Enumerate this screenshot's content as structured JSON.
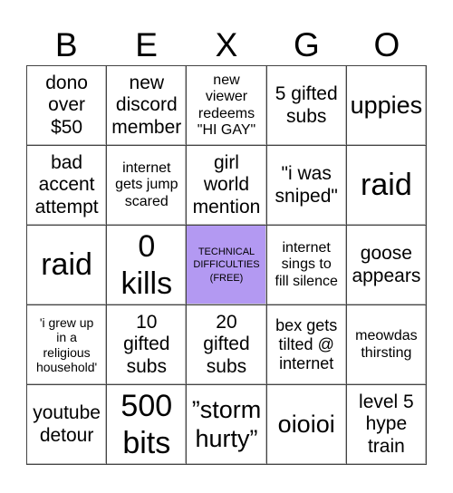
{
  "header": [
    "B",
    "E",
    "X",
    "G",
    "O"
  ],
  "free_color": "#b399f2",
  "cells": [
    {
      "text": "dono over $50",
      "lines": [
        "dono",
        "over",
        "$50"
      ],
      "size": "s-m"
    },
    {
      "text": "new discord member",
      "lines": [
        "new",
        "discord",
        "member"
      ],
      "size": "s-m"
    },
    {
      "text": "new viewer redeems \"HI GAY\"",
      "lines": [
        "new",
        "viewer",
        "redeems",
        "\"HI GAY\""
      ],
      "size": "s-xs"
    },
    {
      "text": "5 gifted subs",
      "lines": [
        "5 gifted",
        "subs"
      ],
      "size": "s-m"
    },
    {
      "text": "uppies",
      "lines": [
        "uppies"
      ],
      "size": "s-l"
    },
    {
      "text": "bad accent attempt",
      "lines": [
        "bad",
        "accent",
        "attempt"
      ],
      "size": "s-m"
    },
    {
      "text": "internet gets jump scared",
      "lines": [
        "internet",
        "gets jump",
        "scared"
      ],
      "size": "s-xs"
    },
    {
      "text": "girl world mention",
      "lines": [
        "girl",
        "world",
        "mention"
      ],
      "size": "s-m"
    },
    {
      "text": "\"i was sniped\"",
      "lines": [
        "\"i was",
        "sniped\""
      ],
      "size": "s-m"
    },
    {
      "text": "raid",
      "lines": [
        "raid"
      ],
      "size": "s-xl"
    },
    {
      "text": "raid",
      "lines": [
        "raid"
      ],
      "size": "s-xl"
    },
    {
      "text": "0 kills",
      "lines": [
        "0",
        "kills"
      ],
      "size": "s-xl"
    },
    {
      "text": "TECHNICAL DIFFICULTIES (FREE)",
      "lines": [
        "TECHNICAL",
        "DIFFICULTIES",
        "(FREE)"
      ],
      "size": "s-tiny",
      "free": true
    },
    {
      "text": "internet sings to fill silence",
      "lines": [
        "internet",
        "sings to",
        "fill silence"
      ],
      "size": "s-xs"
    },
    {
      "text": "goose appears",
      "lines": [
        "goose",
        "appears"
      ],
      "size": "s-m"
    },
    {
      "text": "'i grew up in a religious household'",
      "lines": [
        "'i grew up",
        "in a",
        "religious",
        "household'"
      ],
      "size": "s-xxs"
    },
    {
      "text": "10 gifted subs",
      "lines": [
        "10",
        "gifted",
        "subs"
      ],
      "size": "s-m"
    },
    {
      "text": "20 gifted subs",
      "lines": [
        "20",
        "gifted",
        "subs"
      ],
      "size": "s-m"
    },
    {
      "text": "bex gets tilted @ internet",
      "lines": [
        "bex gets",
        "tilted @",
        "internet"
      ],
      "size": "s-s"
    },
    {
      "text": "meowdas thirsting",
      "lines": [
        "meowdas",
        "thirsting"
      ],
      "size": "s-xs"
    },
    {
      "text": "youtube detour",
      "lines": [
        "youtube",
        "detour"
      ],
      "size": "s-m"
    },
    {
      "text": "500 bits",
      "lines": [
        "500",
        "bits"
      ],
      "size": "s-xl"
    },
    {
      "text": "”storm hurty”",
      "lines": [
        "”storm",
        "hurty”"
      ],
      "size": "s-l"
    },
    {
      "text": "oioioi",
      "lines": [
        "oioioi"
      ],
      "size": "s-l"
    },
    {
      "text": "level 5 hype train",
      "lines": [
        "level 5",
        "hype",
        "train"
      ],
      "size": "s-m"
    }
  ]
}
